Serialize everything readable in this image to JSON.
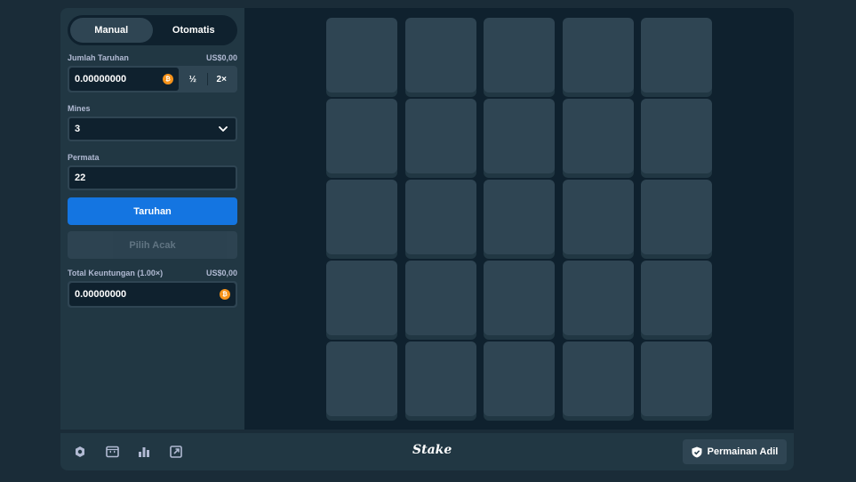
{
  "sidebar": {
    "mode_tabs": [
      {
        "label": "Manual",
        "active": true
      },
      {
        "label": "Otomatis",
        "active": false
      }
    ],
    "bet_amount": {
      "label": "Jumlah Taruhan",
      "usd_value": "US$0,00",
      "value": "0.00000000",
      "currency_icon": "bitcoin-coin-icon",
      "half_label": "½",
      "double_label": "2×"
    },
    "mines": {
      "label": "Mines",
      "value": "3"
    },
    "gems": {
      "label": "Permata",
      "value": "22"
    },
    "bet_button_label": "Taruhan",
    "random_button_label": "Pilih Acak",
    "total_profit": {
      "label": "Total Keuntungan (1.00×)",
      "usd_value": "US$0,00",
      "value": "0.00000000"
    }
  },
  "board": {
    "rows": 5,
    "cols": 5,
    "tile_count": 25
  },
  "footer": {
    "icons": [
      "settings-icon",
      "theatre-mode-icon",
      "stats-icon",
      "popout-icon"
    ],
    "logo_text": "Stake",
    "fair_button_label": "Permainan Adil"
  },
  "colors": {
    "background": "#1a2c38",
    "panel": "#213743",
    "dark": "#0f212e",
    "tile": "#2f4553",
    "accent": "#1475e1",
    "coin": "#f7931a"
  }
}
